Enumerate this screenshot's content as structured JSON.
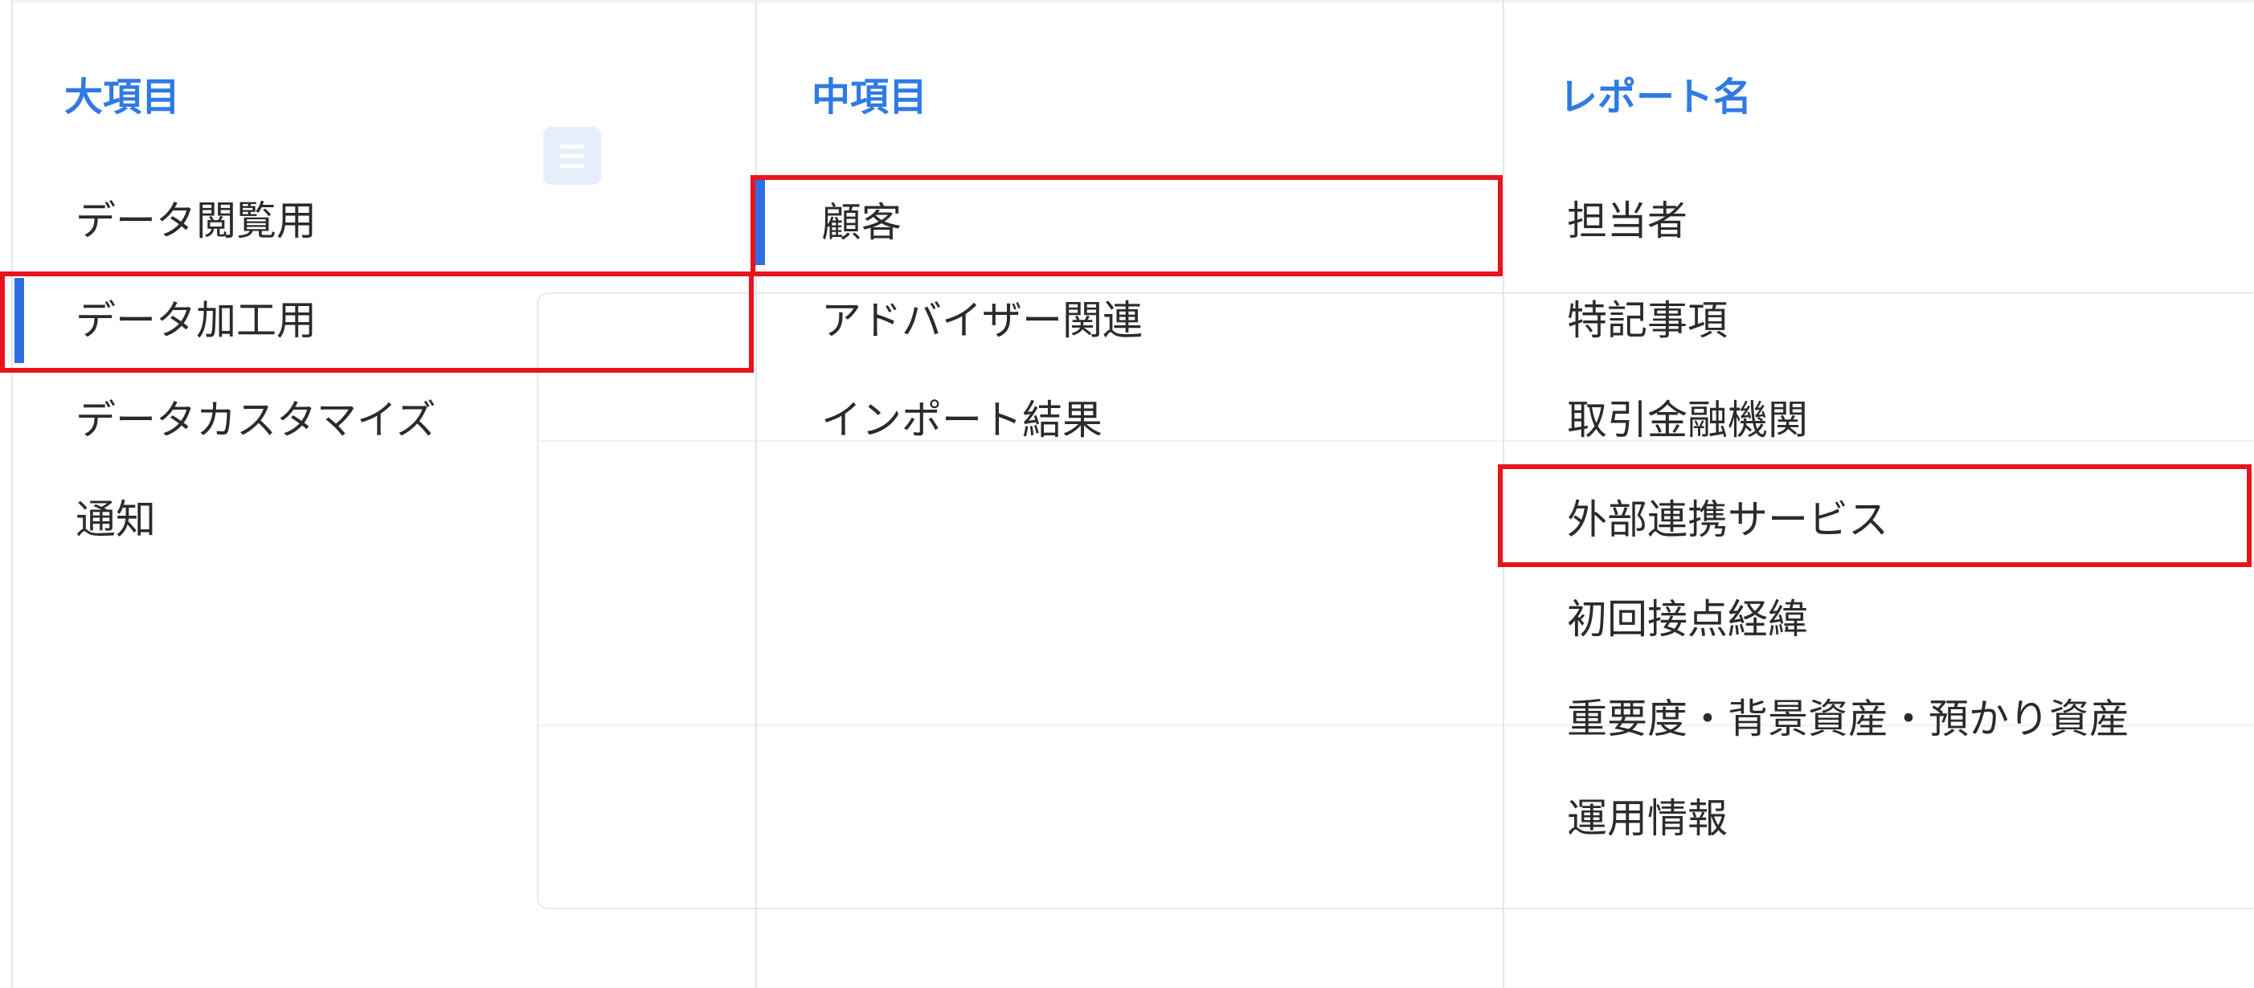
{
  "columns": [
    {
      "header": "大項目",
      "items": [
        "データ閲覧用",
        "データ加工用",
        "データカスタマイズ",
        "通知"
      ],
      "selected_index": 1,
      "highlighted_index": 1
    },
    {
      "header": "中項目",
      "items": [
        "顧客",
        "アドバイザー関連",
        "インポート結果"
      ],
      "selected_index": 0,
      "highlighted_index": 0
    },
    {
      "header": "レポート名",
      "items": [
        "担当者",
        "特記事項",
        "取引金融機関",
        "外部連携サービス",
        "初回接点経緯",
        "重要度・背景資産・預かり資産",
        "運用情報"
      ],
      "selected_index": null,
      "highlighted_index": 3
    }
  ],
  "colors": {
    "header": "#2f7ae5",
    "selected_bar": "#2f6de4",
    "highlight_outline": "#e8141c"
  },
  "icons": [
    "document-icon"
  ]
}
